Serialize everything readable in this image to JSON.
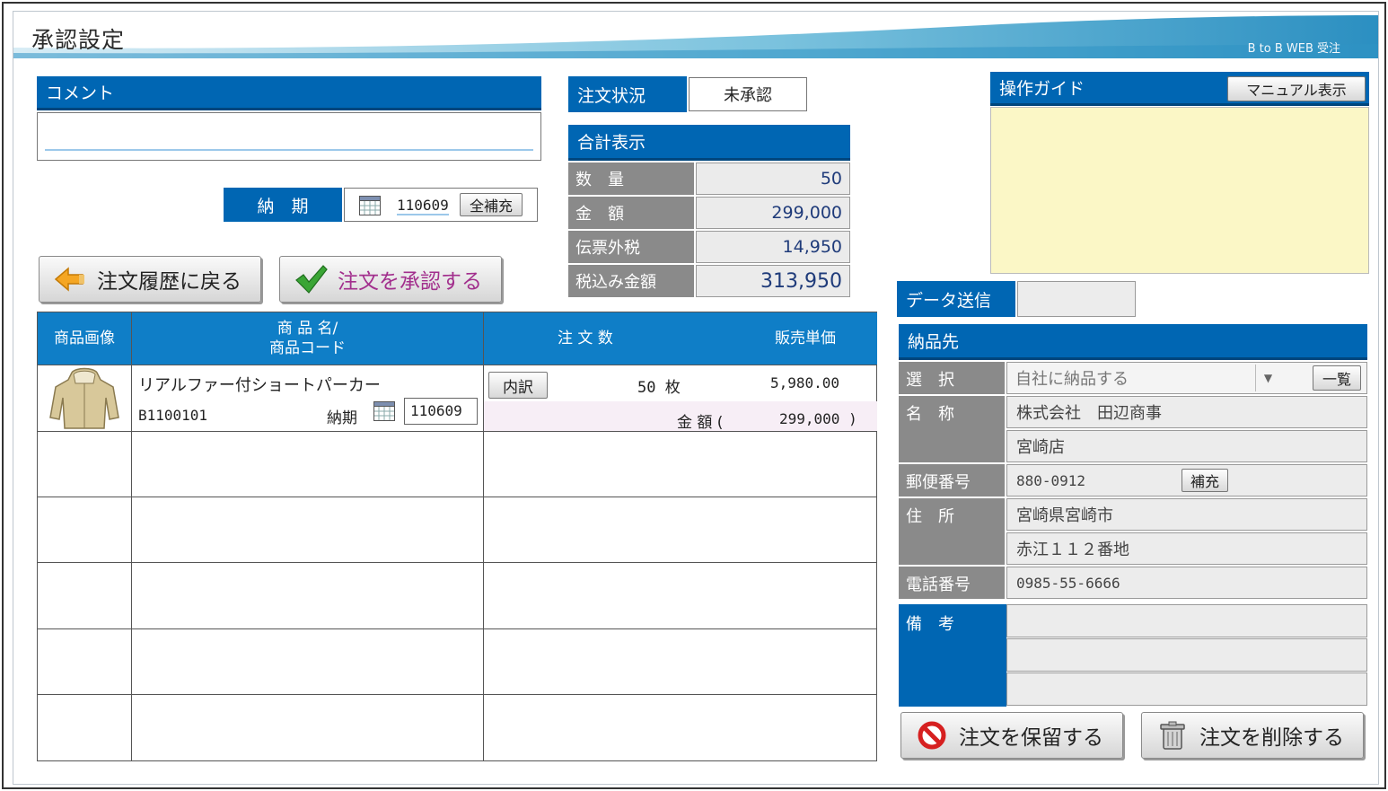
{
  "header": {
    "title": "承認設定",
    "brand": "B to B WEB 受注"
  },
  "comment": {
    "label": "コメント",
    "value": ""
  },
  "delivery_date": {
    "label": "納　期",
    "value": "110609",
    "fill_button": "全補充"
  },
  "order_status": {
    "label": "注文状況",
    "value": "未承認"
  },
  "totals": {
    "title": "合計表示",
    "rows": [
      {
        "label": "数　量",
        "value": "50"
      },
      {
        "label": "金　額",
        "value": "299,000"
      },
      {
        "label": "伝票外税",
        "value": "14,950"
      },
      {
        "label": "税込み金額",
        "value": "313,950"
      }
    ]
  },
  "guide": {
    "label": "操作ガイド",
    "manual_button": "マニュアル表示"
  },
  "actions": {
    "back": "注文履歴に戻る",
    "approve": "注文を承認する",
    "hold": "注文を保留する",
    "delete": "注文を削除する"
  },
  "table": {
    "headers": {
      "image": "商品画像",
      "name_line1": "商 品 名/",
      "name_line2": "商品コード",
      "qty": "注 文 数",
      "price": "販売単価"
    },
    "rows": [
      {
        "name": "リアルファー付ショートパーカー",
        "code": "B1100101",
        "due_label": "納期",
        "due_value": "110609",
        "detail_button": "内訳",
        "qty": "50 枚",
        "price": "5,980.00",
        "amount_label": "金 額 (",
        "amount_value": "299,000 )"
      }
    ]
  },
  "data_send": {
    "label": "データ送信",
    "value": ""
  },
  "ship_to": {
    "title": "納品先",
    "select_label": "選　択",
    "select_value": "自社に納品する",
    "list_button": "一覧",
    "name_label": "名　称",
    "name_line1": "株式会社　田辺商事",
    "name_line2": "宮崎店",
    "zip_label": "郵便番号",
    "zip_value": "880-0912",
    "zip_fill": "補充",
    "address_label": "住　所",
    "address_line1": "宮崎県宮崎市",
    "address_line2": "赤江１１２番地",
    "tel_label": "電話番号",
    "tel_value": "0985-55-6666",
    "notes_label": "備　考"
  }
}
